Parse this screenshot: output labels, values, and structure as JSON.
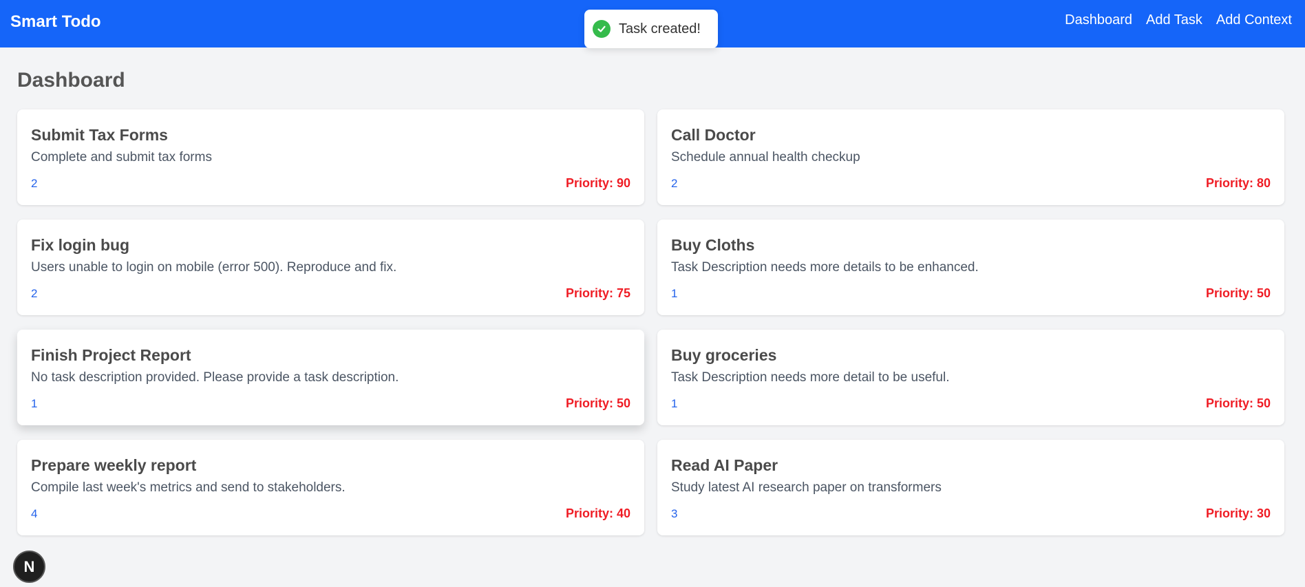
{
  "header": {
    "brand": "Smart Todo",
    "nav": {
      "dashboard": "Dashboard",
      "add_task": "Add Task",
      "add_context": "Add Context"
    }
  },
  "toast": {
    "message": "Task created!",
    "icon": "check-circle-icon",
    "icon_color": "#35bb4b"
  },
  "page": {
    "title": "Dashboard"
  },
  "tasks": [
    {
      "title": "Submit Tax Forms",
      "description": "Complete and submit tax forms",
      "count": "2",
      "priority": "Priority: 90"
    },
    {
      "title": "Call Doctor",
      "description": "Schedule annual health checkup",
      "count": "2",
      "priority": "Priority: 80"
    },
    {
      "title": "Fix login bug",
      "description": "Users unable to login on mobile (error 500). Reproduce and fix.",
      "count": "2",
      "priority": "Priority: 75"
    },
    {
      "title": "Buy Cloths",
      "description": "Task Description needs more details to be enhanced.",
      "count": "1",
      "priority": "Priority: 50"
    },
    {
      "title": "Finish Project Report",
      "description": "No task description provided. Please provide a task description.",
      "count": "1",
      "priority": "Priority: 50"
    },
    {
      "title": "Buy groceries",
      "description": "Task Description needs more detail to be useful.",
      "count": "1",
      "priority": "Priority: 50"
    },
    {
      "title": "Prepare weekly report",
      "description": "Compile last week's metrics and send to stakeholders.",
      "count": "4",
      "priority": "Priority: 40"
    },
    {
      "title": "Read AI Paper",
      "description": "Study latest AI research paper on transformers",
      "count": "3",
      "priority": "Priority: 30"
    }
  ],
  "dev_badge": {
    "label": "N"
  },
  "colors": {
    "header": "#1565f9",
    "priority": "#ef1c24",
    "count": "#2563eb",
    "background": "#f3f4f6"
  }
}
